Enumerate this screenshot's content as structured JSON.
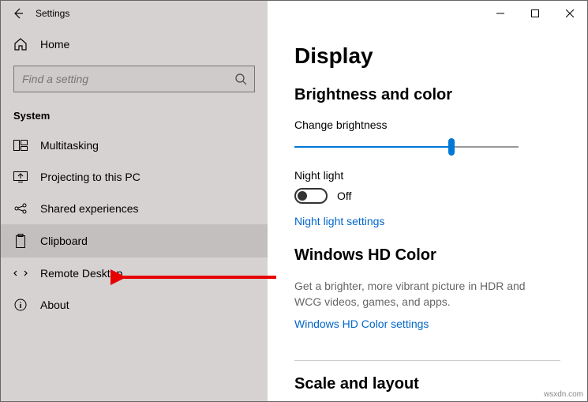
{
  "window": {
    "title": "Settings"
  },
  "sidebar": {
    "home_label": "Home",
    "search_placeholder": "Find a setting",
    "category": "System",
    "items": [
      {
        "label": "Multitasking"
      },
      {
        "label": "Projecting to this PC"
      },
      {
        "label": "Shared experiences"
      },
      {
        "label": "Clipboard"
      },
      {
        "label": "Remote Desktop"
      },
      {
        "label": "About"
      }
    ]
  },
  "main": {
    "page_title": "Display",
    "brightness_section": "Brightness and color",
    "brightness_label": "Change brightness",
    "brightness_value": 70,
    "nightlight_label": "Night light",
    "nightlight_state": "Off",
    "nightlight_link": "Night light settings",
    "hdcolor_title": "Windows HD Color",
    "hdcolor_desc": "Get a brighter, more vibrant picture in HDR and WCG videos, games, and apps.",
    "hdcolor_link": "Windows HD Color settings",
    "scale_title": "Scale and layout"
  },
  "watermark": "wsxdn.com"
}
